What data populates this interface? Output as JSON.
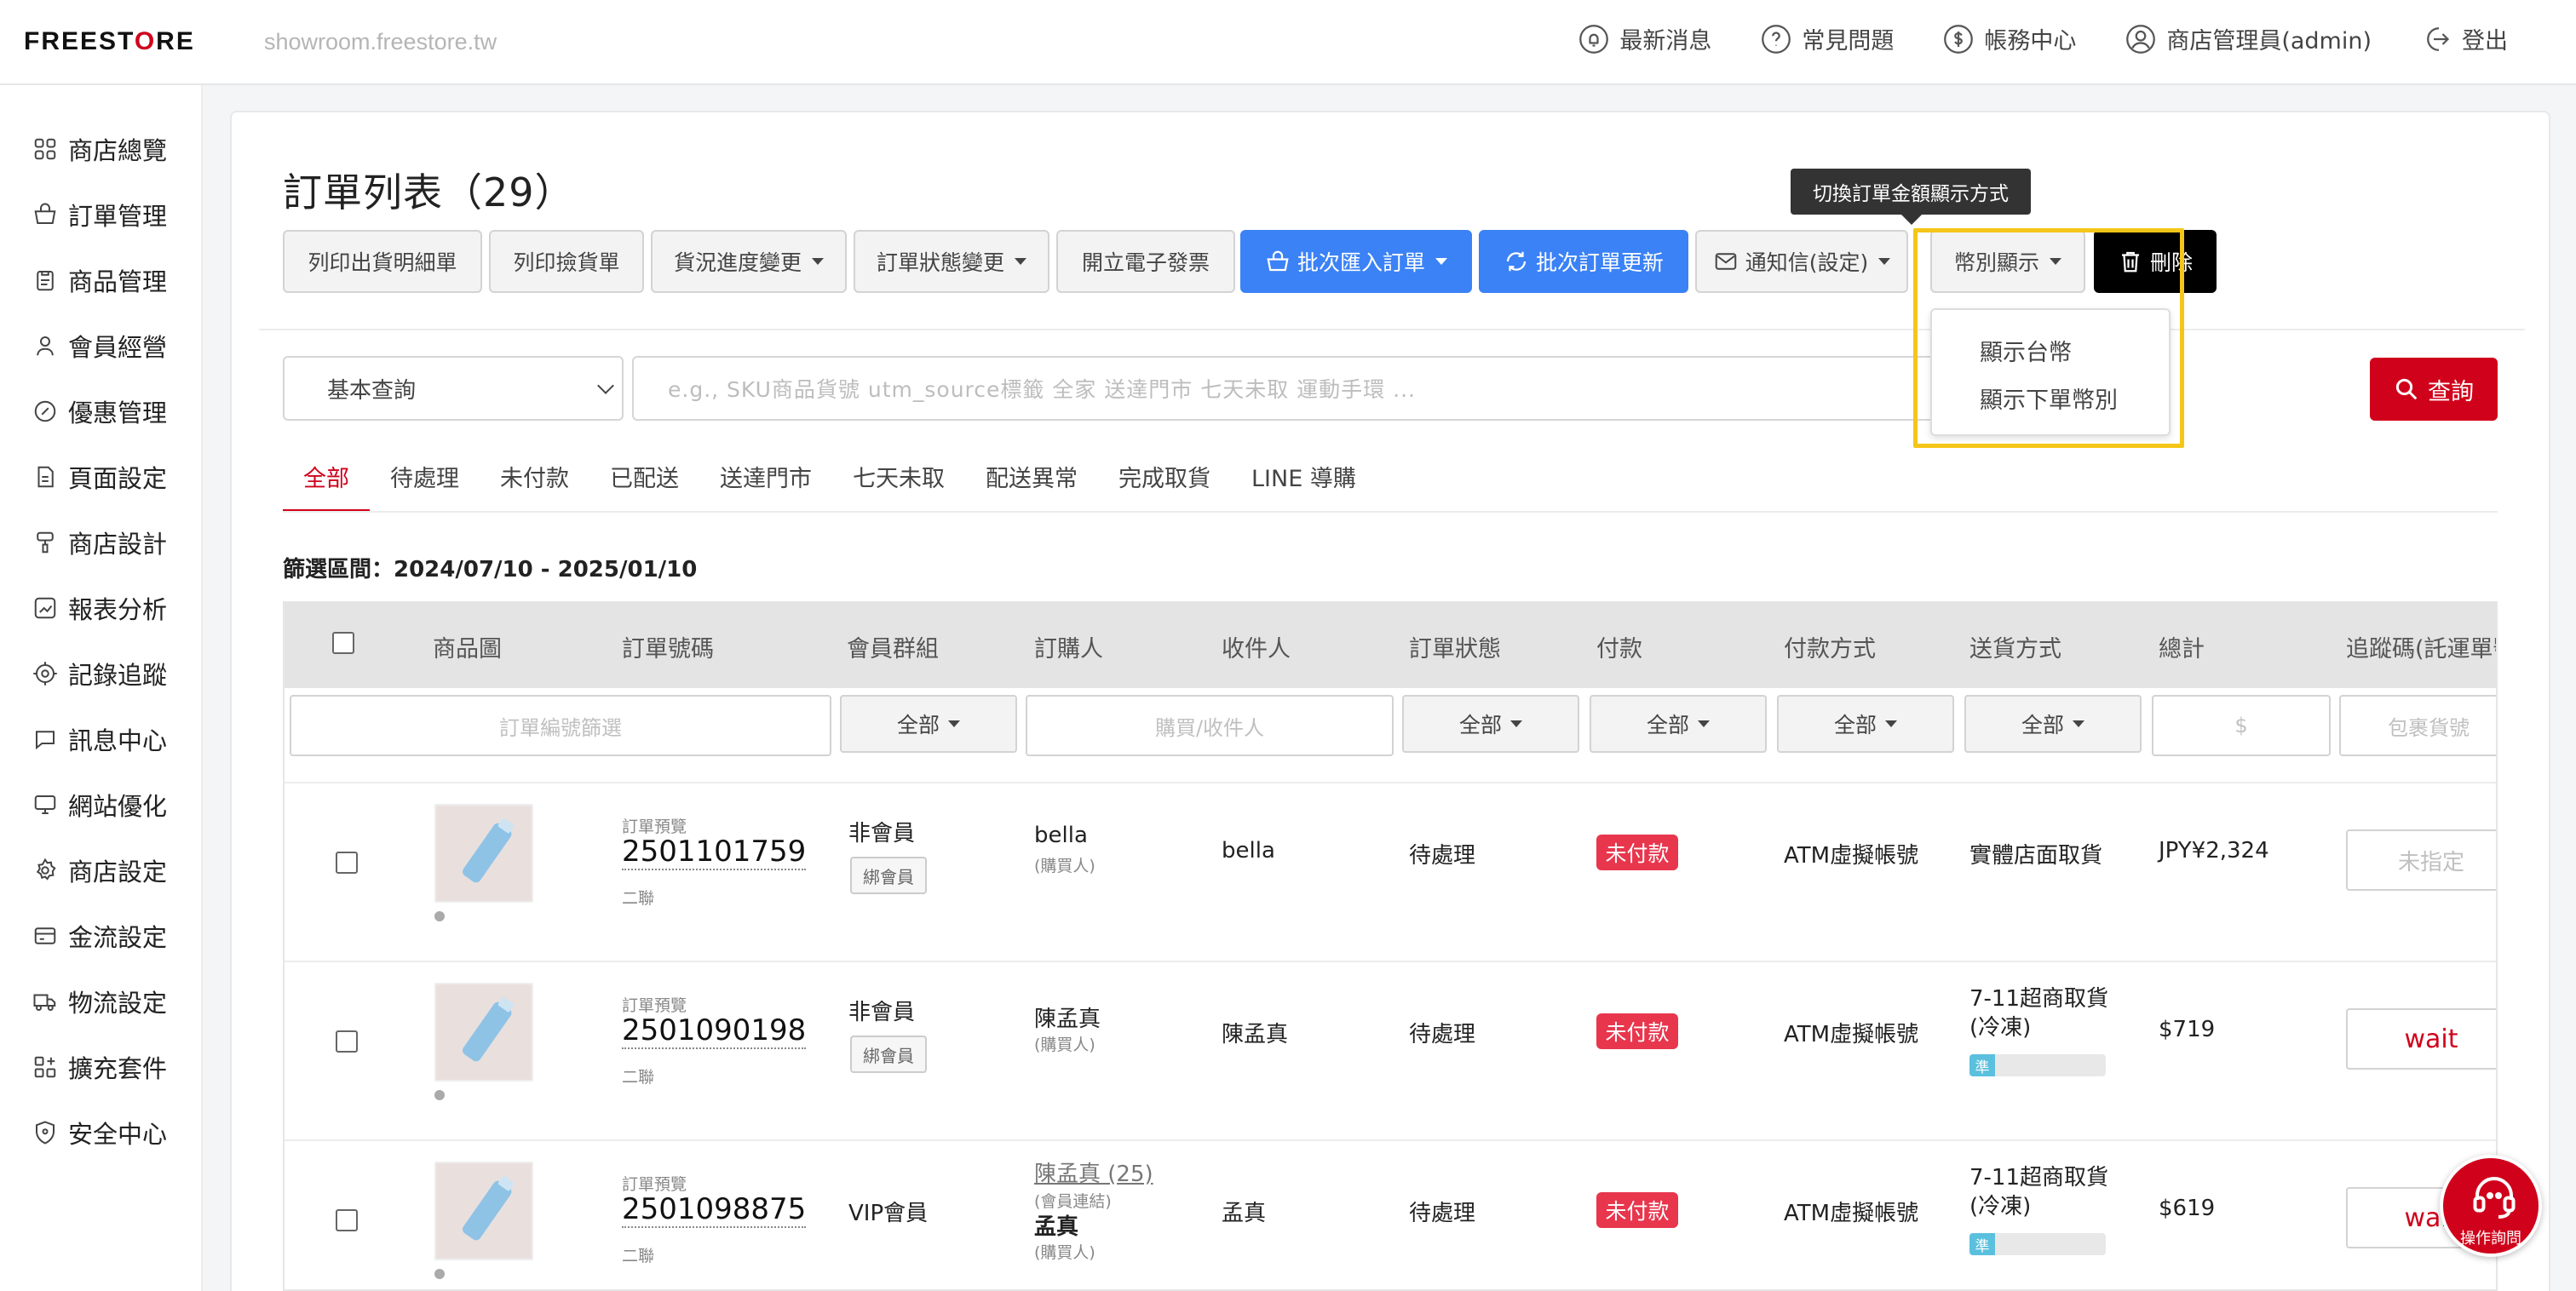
{
  "header": {
    "logo": "FREESTORE",
    "domain": "showroom.freestore.tw",
    "nav": [
      {
        "label": "最新消息",
        "icon": "bell-icon"
      },
      {
        "label": "常見問題",
        "icon": "question-icon"
      },
      {
        "label": "帳務中心",
        "icon": "dollar-icon"
      },
      {
        "label": "商店管理員(admin)",
        "icon": "user-icon"
      },
      {
        "label": "登出",
        "icon": "logout-icon"
      }
    ]
  },
  "sidebar": {
    "items": [
      {
        "label": "商店總覽",
        "icon": "grid-icon"
      },
      {
        "label": "訂單管理",
        "icon": "basket-icon"
      },
      {
        "label": "商品管理",
        "icon": "clipboard-icon"
      },
      {
        "label": "會員經營",
        "icon": "person-icon"
      },
      {
        "label": "優惠管理",
        "icon": "coupon-icon"
      },
      {
        "label": "頁面設定",
        "icon": "page-icon"
      },
      {
        "label": "商店設計",
        "icon": "brush-icon"
      },
      {
        "label": "報表分析",
        "icon": "chart-icon"
      },
      {
        "label": "記錄追蹤",
        "icon": "target-icon"
      },
      {
        "label": "訊息中心",
        "icon": "message-icon"
      },
      {
        "label": "網站優化",
        "icon": "monitor-icon"
      },
      {
        "label": "商店設定",
        "icon": "gear-icon"
      },
      {
        "label": "金流設定",
        "icon": "card-icon"
      },
      {
        "label": "物流設定",
        "icon": "truck-icon"
      },
      {
        "label": "擴充套件",
        "icon": "puzzle-icon"
      },
      {
        "label": "安全中心",
        "icon": "shield-icon"
      }
    ]
  },
  "page": {
    "title": "訂單列表（29）"
  },
  "toolbar": {
    "print_shipping": "列印出貨明細單",
    "print_picking": "列印撿貨單",
    "shipping_progress": "貨況進度變更",
    "order_status": "訂單狀態變更",
    "e_invoice": "開立電子發票",
    "batch_import": "批次匯入訂單",
    "batch_update": "批次訂單更新",
    "notify": "通知信(設定)",
    "currency": "幣別顯示",
    "delete": "刪除"
  },
  "tooltip": "切換訂單金額顯示方式",
  "currency_menu": {
    "options": [
      "顯示台幣",
      "顯示下單幣別"
    ]
  },
  "search": {
    "mode": "基本查詢",
    "placeholder": "e.g.,  SKU商品貨號   utm_source標籤   全家   送達門市   七天未取   運動手環  ...",
    "button": "查詢"
  },
  "tabs": [
    "全部",
    "待處理",
    "未付款",
    "已配送",
    "送達門市",
    "七天未取",
    "配送異常",
    "完成取貨",
    "LINE 導購"
  ],
  "filter_range": "篩選區間：2024/07/10 - 2025/01/10",
  "table": {
    "columns": [
      "商品圖",
      "訂單號碼",
      "會員群組",
      "訂購人",
      "收件人",
      "訂單狀態",
      "付款",
      "付款方式",
      "送貨方式",
      "總計",
      "追蹤碼(託運單號"
    ],
    "filters": {
      "order_no_placeholder": "訂單編號篩選",
      "member_group": "全部",
      "buyer_placeholder": "購買/收件人",
      "status": "全部",
      "payment": "全部",
      "payment_method": "全部",
      "shipping": "全部",
      "total_placeholder": "$",
      "tracking_placeholder": "包裹貨號"
    },
    "rows": [
      {
        "pre_label": "訂單預覽",
        "order_no": "2501101759",
        "sub_label": "二聯",
        "member_group": "非會員",
        "bind_label": "綁會員",
        "buyer": "bella",
        "buyer_role": "(購買人)",
        "receiver": "bella",
        "status": "待處理",
        "payment": "未付款",
        "payment_method": "ATM虛擬帳號",
        "shipping": "實體店面取貨",
        "total": "JPY¥2,324",
        "tracking": "未指定"
      },
      {
        "pre_label": "訂單預覽",
        "order_no": "2501090198",
        "sub_label": "二聯",
        "member_group": "非會員",
        "bind_label": "綁會員",
        "buyer": "陳孟真",
        "buyer_role": "(購買人)",
        "receiver": "陳孟真",
        "status": "待處理",
        "payment": "未付款",
        "payment_method": "ATM虛擬帳號",
        "shipping_line1": "7-11超商取貨",
        "shipping_line2": "(冷凍)",
        "progress_label": "準",
        "total": "$719",
        "tracking": "wait"
      },
      {
        "pre_label": "訂單預覽",
        "order_no": "2501098875",
        "sub_label": "二聯",
        "member_group": "VIP會員",
        "buyer_link": "陳孟真 (25)",
        "buyer_link_role": "(會員連結)",
        "buyer": "孟真",
        "buyer_role": "(購買人)",
        "receiver": "孟真",
        "status": "待處理",
        "payment": "未付款",
        "payment_method": "ATM虛擬帳號",
        "shipping_line1": "7-11超商取貨",
        "shipping_line2": "(冷凍)",
        "progress_label": "準",
        "total": "$619",
        "tracking": "wait"
      }
    ]
  },
  "helper": {
    "label": "操作詢問"
  },
  "colors": {
    "brand_red": "#d0021b",
    "blue": "#3b82f6",
    "highlight": "#f5c518",
    "unpaid": "#e8364d"
  }
}
